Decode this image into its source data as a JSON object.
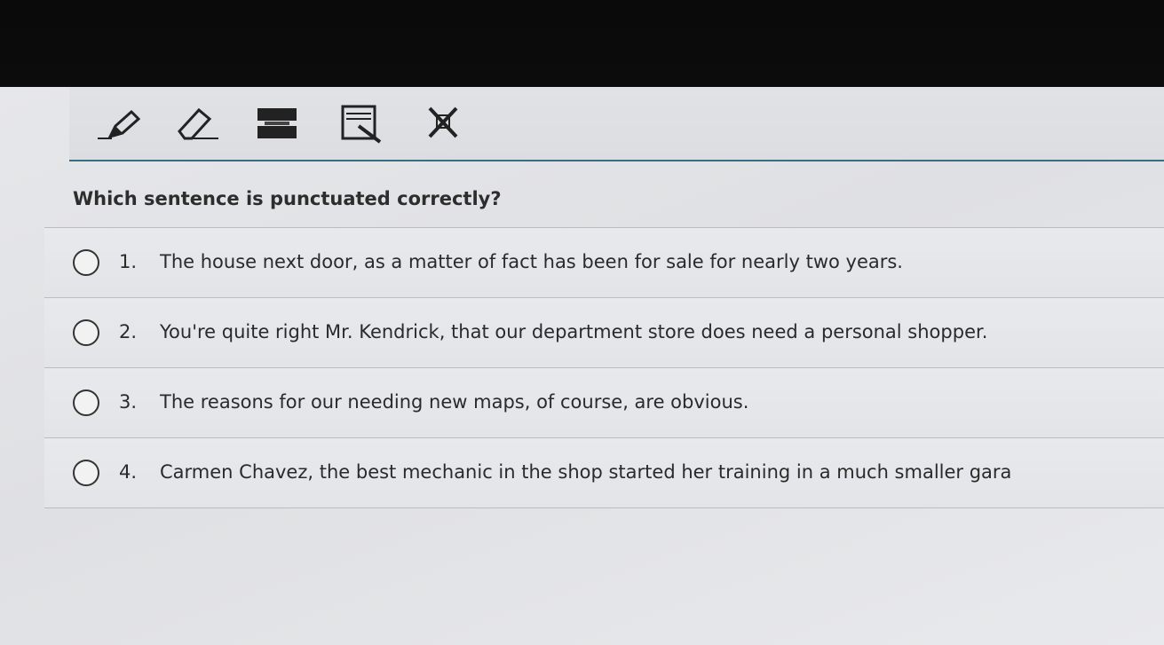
{
  "question": "Which sentence is punctuated correctly?",
  "toolbar": {
    "tools": [
      "pencil-icon",
      "eraser-icon",
      "line-reader-icon",
      "reader-mask-icon",
      "answer-eliminator-icon"
    ]
  },
  "options": [
    {
      "number": "1.",
      "text": "The house next door, as a matter of fact has been for sale for nearly two years."
    },
    {
      "number": "2.",
      "text": "You're quite right Mr. Kendrick, that our department store does need a personal shopper."
    },
    {
      "number": "3.",
      "text": "The reasons for our needing new maps, of course, are obvious."
    },
    {
      "number": "4.",
      "text": "Carmen Chavez, the best mechanic in the shop started her training in a much smaller gara"
    }
  ],
  "colors": {
    "accent_line": "#3c6c84",
    "panel": "#e3e4e7"
  }
}
